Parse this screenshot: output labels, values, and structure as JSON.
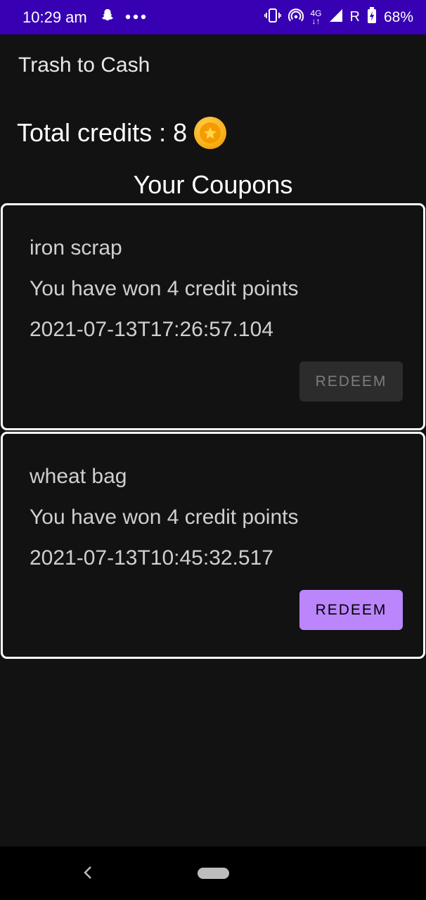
{
  "status_bar": {
    "time": "10:29 am",
    "network_label": "4G",
    "roaming_label": "R",
    "battery_percent": "68%",
    "icons": [
      "snapchat-icon",
      "more-dots-icon",
      "vibrate-icon",
      "hotspot-icon",
      "signal-icon",
      "battery-icon"
    ],
    "background_color": "#3700b3"
  },
  "app": {
    "title": "Trash to Cash"
  },
  "credits": {
    "label": "Total credits : 8",
    "icon": "coin-star-icon"
  },
  "coupons_section": {
    "heading": "Your Coupons",
    "items": [
      {
        "title": "iron scrap",
        "message": "You have won 4 credit points",
        "date": "2021-07-13T17:26:57.104",
        "button_label": "REDEEM",
        "button_enabled": false
      },
      {
        "title": "wheat bag",
        "message": "You have won 4 credit points",
        "date": "2021-07-13T10:45:32.517",
        "button_label": "REDEEM",
        "button_enabled": true
      }
    ]
  },
  "nav_bar": {
    "icons": [
      "back-chevron-icon",
      "home-pill-icon"
    ]
  },
  "colors": {
    "background": "#121212",
    "accent": "#bb86fc",
    "card_border": "#ffffff"
  }
}
